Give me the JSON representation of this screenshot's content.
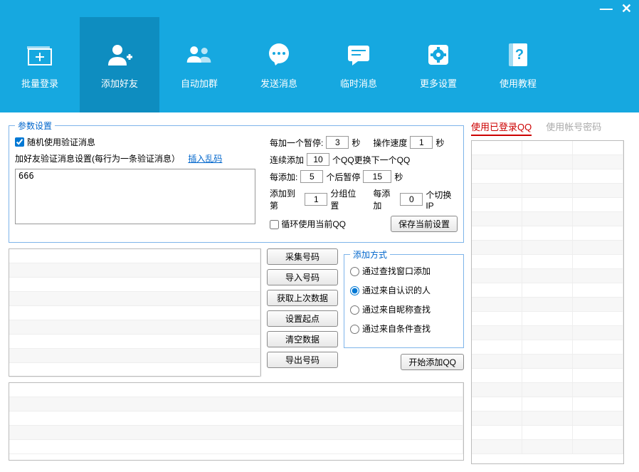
{
  "titlebar": {
    "min": "—",
    "close": "✕"
  },
  "toolbar": [
    {
      "id": "batch-login",
      "label": "批量登录"
    },
    {
      "id": "add-friend",
      "label": "添加好友"
    },
    {
      "id": "auto-group",
      "label": "自动加群"
    },
    {
      "id": "send-msg",
      "label": "发送消息"
    },
    {
      "id": "temp-msg",
      "label": "临时消息"
    },
    {
      "id": "more-set",
      "label": "更多设置"
    },
    {
      "id": "tutorial",
      "label": "使用教程"
    }
  ],
  "params": {
    "legend": "参数设置",
    "random_verify_label": "随机使用验证消息",
    "random_verify_checked": true,
    "desc": "加好友验证消息设置(每行为一条验证消息）",
    "insert_link": "插入乱码",
    "msg_text": "666",
    "pause_each_label_a": "每加一个暂停:",
    "pause_each_val": "3",
    "pause_each_label_b": "秒",
    "speed_label_a": "操作速度",
    "speed_val": "1",
    "speed_label_b": "秒",
    "cont_add_label_a": "连续添加",
    "cont_add_val": "10",
    "cont_add_label_b": "个QQ更换下一个QQ",
    "each_add_label_a": "每添加:",
    "each_add_val": "5",
    "each_add_label_b": "个后暂停",
    "each_pause_val": "15",
    "each_pause_label": "秒",
    "add_to_label_a": "添加到第",
    "add_to_val": "1",
    "add_to_label_b": "分组位置",
    "switch_label_a": "每添加",
    "switch_val": "0",
    "switch_label_b": "个切换IP",
    "loop_label": "循环使用当前QQ",
    "loop_checked": false,
    "save_btn": "保存当前设置"
  },
  "action_buttons": {
    "collect": "采集号码",
    "import": "导入号码",
    "last": "获取上次数据",
    "origin": "设置起点",
    "clear": "清空数据",
    "export": "导出号码"
  },
  "add_method": {
    "legend": "添加方式",
    "opt1": "通过查找窗口添加",
    "opt2": "通过来自认识的人",
    "opt3": "通过来自昵称查找",
    "opt4": "通过来自条件查找",
    "selected": "opt2"
  },
  "start_btn": "开始添加QQ",
  "right_tabs": {
    "tab1": "使用已登录QQ",
    "tab2": "使用帐号密码",
    "active": "tab1"
  }
}
